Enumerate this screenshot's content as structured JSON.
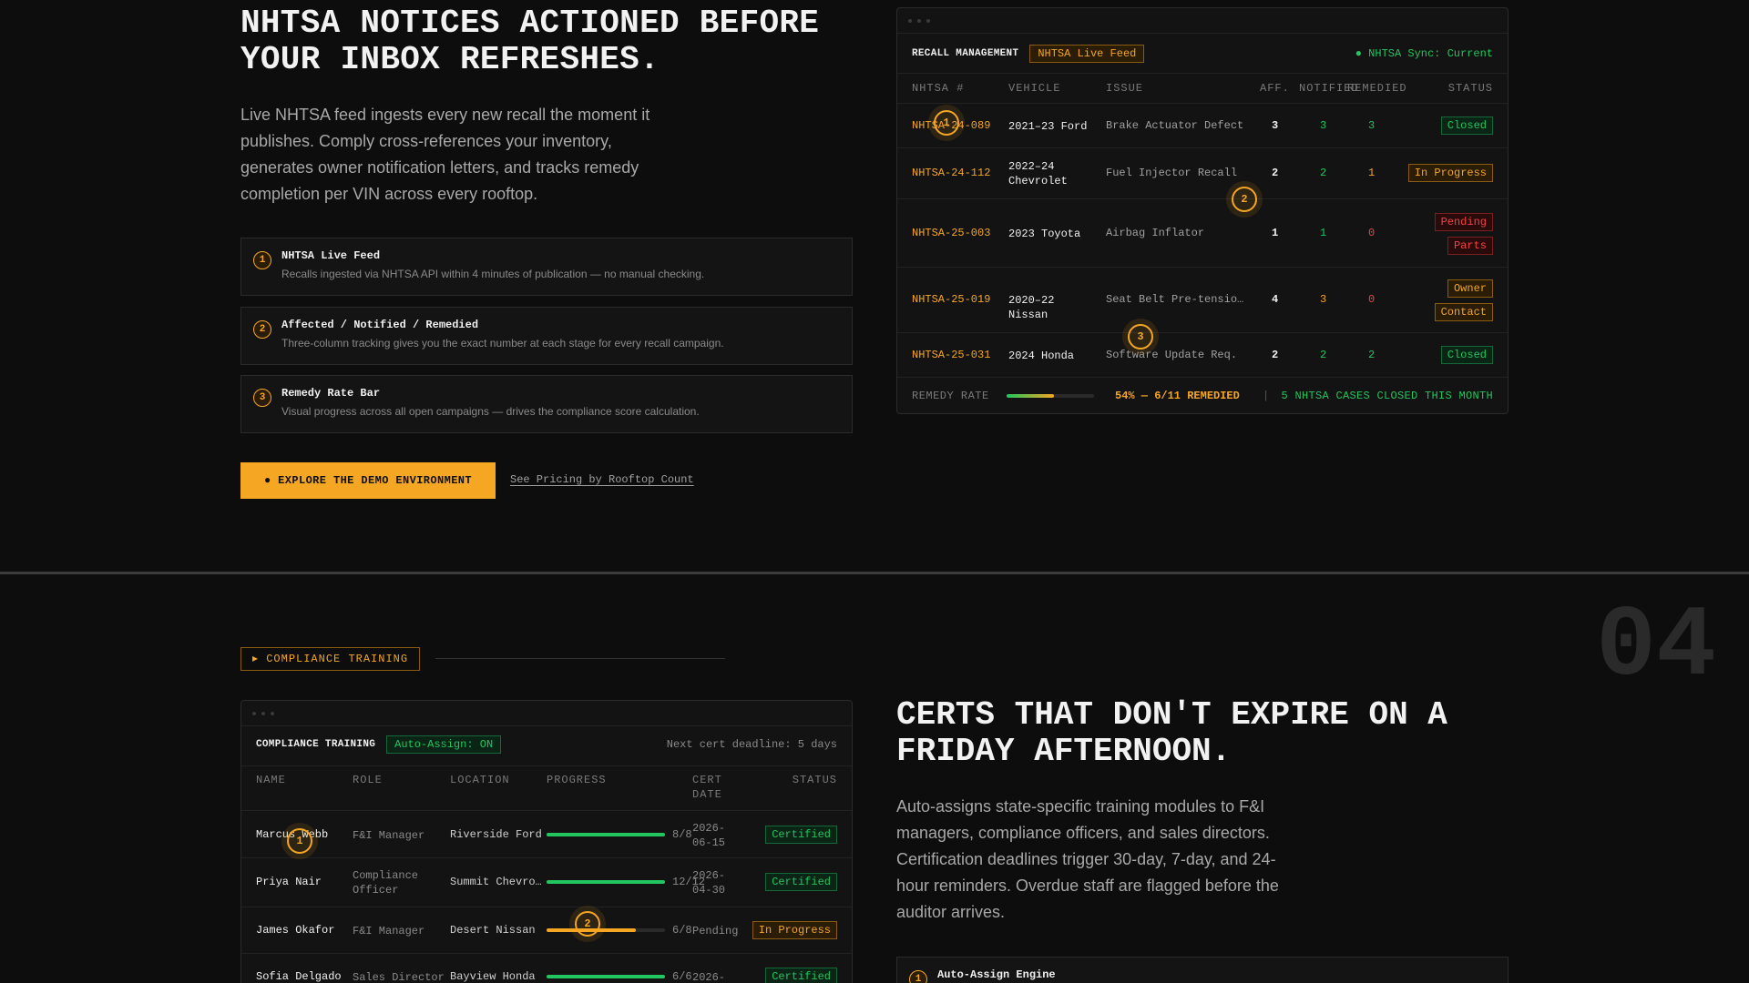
{
  "hero": {
    "title": "NHTSA NOTICES ACTIONED BEFORE YOUR INBOX REFRESHES.",
    "description": "Live NHTSA feed ingests every new recall the moment it publishes. Comply cross-references your inventory, generates owner notification letters, and tracks remedy completion per VIN across every rooftop."
  },
  "features": [
    {
      "num": "1",
      "title": "NHTSA Live Feed",
      "desc": "Recalls ingested via NHTSA API within 4 minutes of publication — no manual checking."
    },
    {
      "num": "2",
      "title": "Affected / Notified / Remedied",
      "desc": "Three-column tracking gives you the exact number at each stage for every recall campaign."
    },
    {
      "num": "3",
      "title": "Remedy Rate Bar",
      "desc": "Visual progress across all open campaigns — drives the compliance score calculation."
    }
  ],
  "cta": {
    "primary": "● EXPLORE THE DEMO ENVIRONMENT",
    "secondary": "See Pricing by Rooftop Count"
  },
  "recall_panel": {
    "title": "RECALL MANAGEMENT",
    "feed_pill": "NHTSA Live Feed",
    "sync": "● NHTSA Sync: Current",
    "headers": [
      "NHTSA #",
      "VEHICLE",
      "ISSUE",
      "AFF.",
      "NOTIFIED",
      "REMEDIED",
      "STATUS"
    ],
    "rows": [
      {
        "id": "NHTSA-24-089",
        "vehicle": "2021–23 Ford",
        "issue": "Brake Actuator Defect",
        "aff": "3",
        "notified": "3",
        "remedied": "3",
        "status1": "Closed",
        "status2": "",
        "kind": "closed",
        "notified_color": "#22c55e",
        "remedied_color": "#22c55e"
      },
      {
        "id": "NHTSA-24-112",
        "vehicle": "2022–24 Chevrolet",
        "issue": "Fuel Injector Recall",
        "aff": "2",
        "notified": "2",
        "remedied": "1",
        "status1": "In Progress",
        "status2": "",
        "kind": "progress",
        "notified_color": "#22c55e",
        "remedied_color": "#f5a623"
      },
      {
        "id": "NHTSA-25-003",
        "vehicle": "2023 Toyota",
        "issue": "Airbag Inflator",
        "aff": "1",
        "notified": "1",
        "remedied": "0",
        "status1": "Pending",
        "status2": "Parts",
        "kind": "pending",
        "notified_color": "#22c55e",
        "remedied_color": "#ef4444"
      },
      {
        "id": "NHTSA-25-019",
        "vehicle": "2020–22 Nissan",
        "issue": "Seat Belt Pre-tensio…",
        "aff": "4",
        "notified": "3",
        "remedied": "0",
        "status1": "Owner",
        "status2": "Contact",
        "kind": "progress",
        "notified_color": "#f5a623",
        "remedied_color": "#ef4444"
      },
      {
        "id": "NHTSA-25-031",
        "vehicle": "2024 Honda",
        "issue": "Software Update Req.",
        "aff": "2",
        "notified": "2",
        "remedied": "2",
        "status1": "Closed",
        "status2": "",
        "kind": "closed",
        "notified_color": "#22c55e",
        "remedied_color": "#22c55e"
      }
    ],
    "footer": {
      "label": "REMEDY RATE",
      "rate": 0.54,
      "rate_text": "54% — 6/11 REMEDIED",
      "sep": "|",
      "closed_text": "5 NHTSA CASES CLOSED THIS MONTH"
    },
    "markers": [
      "1",
      "2",
      "3"
    ]
  },
  "section2": {
    "tag": "▸ COMPLIANCE TRAINING",
    "number": "04",
    "title": "CERTS THAT DON'T EXPIRE ON A FRIDAY AFTERNOON.",
    "description": "Auto-assigns state-specific training modules to F&I managers, compliance officers, and sales directors. Certification deadlines trigger 30-day, 7-day, and 24-hour reminders. Overdue staff are flagged before the auditor arrives.",
    "feature1": {
      "num": "1",
      "title": "Auto-Assign Engine"
    }
  },
  "training_panel": {
    "title": "COMPLIANCE TRAINING",
    "pill": "Auto-Assign: ON",
    "deadline": "Next cert deadline: 5 days",
    "headers": [
      "NAME",
      "ROLE",
      "LOCATION",
      "PROGRESS",
      "CERT",
      "DATE",
      "STATUS"
    ],
    "rows": [
      {
        "name": "Marcus Webb",
        "role": "F&I Manager",
        "role2": "",
        "location": "Riverside Ford",
        "progress": 1.0,
        "progress_text": "8/8",
        "date1": "2026-",
        "date2": "06-15",
        "status": "Certified",
        "kind": "closed",
        "bar_color": "#22c55e"
      },
      {
        "name": "Priya Nair",
        "role": "Compliance",
        "role2": "Officer",
        "location": "Summit Chevro…",
        "progress": 1.0,
        "progress_text": "12/12",
        "date1": "2026-",
        "date2": "04-30",
        "status": "Certified",
        "kind": "closed",
        "bar_color": "#22c55e"
      },
      {
        "name": "James Okafor",
        "role": "F&I Manager",
        "role2": "",
        "location": "Desert Nissan",
        "progress": 0.75,
        "progress_text": "6/8",
        "date1": "Pending",
        "date2": "",
        "status": "In Progress",
        "kind": "progress",
        "bar_color": "#f5a623"
      },
      {
        "name": "Sofia Delgado",
        "role": "Sales Director",
        "role2": "",
        "location": "Bayview Honda",
        "progress": 1.0,
        "progress_text": "6/6",
        "date1": "2026-",
        "date2": "",
        "status": "Certified",
        "kind": "closed",
        "bar_color": "#22c55e"
      }
    ],
    "markers": [
      "1",
      "2"
    ]
  }
}
